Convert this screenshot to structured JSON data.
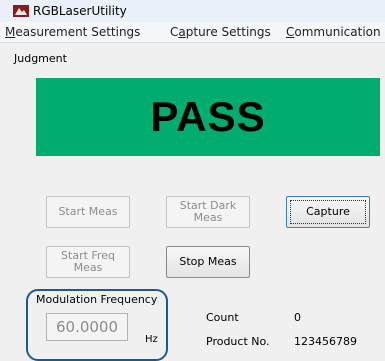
{
  "window": {
    "title": "RGBLaserUtility"
  },
  "menu": [
    {
      "prefix": "",
      "mnemonic": "M",
      "rest": "easurement Settings"
    },
    {
      "prefix": "C",
      "mnemonic": "a",
      "rest": "pture Settings"
    },
    {
      "prefix": "",
      "mnemonic": "C",
      "rest": "ommunication S"
    }
  ],
  "judgment": {
    "label": "Judgment",
    "result": "PASS",
    "result_color": "#00ad6f"
  },
  "buttons": {
    "start_meas": "Start Meas",
    "start_dark_meas": "Start Dark Meas",
    "capture": "Capture",
    "start_freq_meas": "Start Freq Meas",
    "stop_meas": "Stop Meas"
  },
  "modulation": {
    "label": "Modulation Frequency",
    "value": "60.0000",
    "unit": "Hz"
  },
  "info": {
    "count_label": "Count",
    "count_value": "0",
    "product_label": "Product No.",
    "product_value": "123456789"
  }
}
